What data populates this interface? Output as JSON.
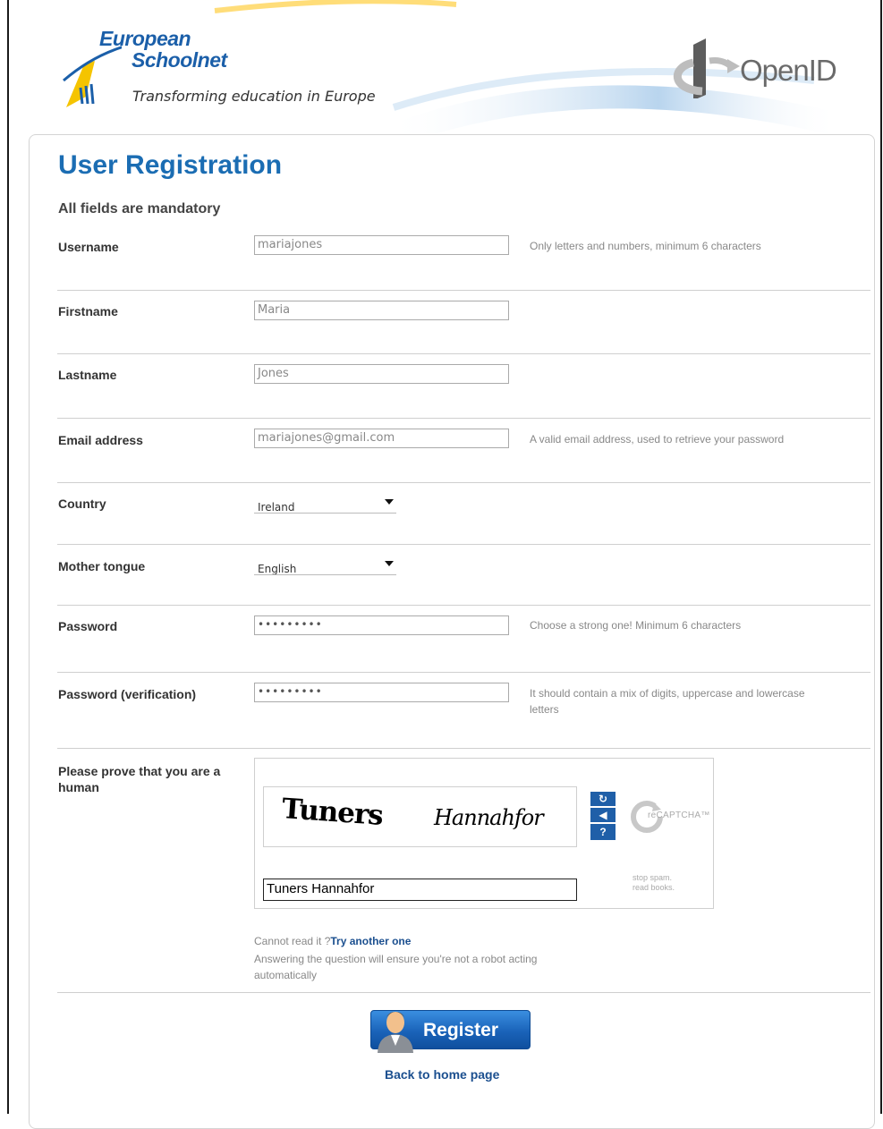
{
  "brand": {
    "name_line1": "European",
    "name_line2": "Schoolnet",
    "tagline": "Transforming education in Europe",
    "openid": "OpenID"
  },
  "page": {
    "title": "User Registration",
    "mandatory_note": "All fields are mandatory"
  },
  "form": {
    "username": {
      "label": "Username",
      "value": "mariajones",
      "hint": "Only letters and numbers, minimum 6 characters"
    },
    "firstname": {
      "label": "Firstname",
      "value": "Maria"
    },
    "lastname": {
      "label": "Lastname",
      "value": "Jones"
    },
    "email": {
      "label": "Email address",
      "value": "mariajones@gmail.com",
      "hint": "A valid email address, used to retrieve your password"
    },
    "country": {
      "label": "Country",
      "value": "Ireland"
    },
    "mother_tongue": {
      "label": "Mother tongue",
      "value": "English"
    },
    "password": {
      "label": "Password",
      "value": "•••••••••",
      "hint": "Choose a strong one! Minimum 6 characters"
    },
    "password_verification": {
      "label": "Password (verification)",
      "value": "•••••••••",
      "hint": "It should contain a mix of digits, uppercase and lowercase letters"
    }
  },
  "captcha": {
    "label": "Please prove that you are a human",
    "word1": "Tuners",
    "word2": "Hannahfor",
    "input_value": "Tuners Hannahfor",
    "logo_text": "reCAPTCHA™",
    "stop_spam_line1": "stop spam.",
    "stop_spam_line2": "read books.",
    "cannot_read": "Cannot read it ?",
    "try_another": "Try another one",
    "explanation": "Answering the question will ensure you're not a robot acting automatically"
  },
  "actions": {
    "register": "Register",
    "back_home": "Back to home page"
  },
  "colors": {
    "title_blue": "#1b6db3",
    "link_blue": "#1b4f8f",
    "button_blue": "#1a63b9"
  }
}
